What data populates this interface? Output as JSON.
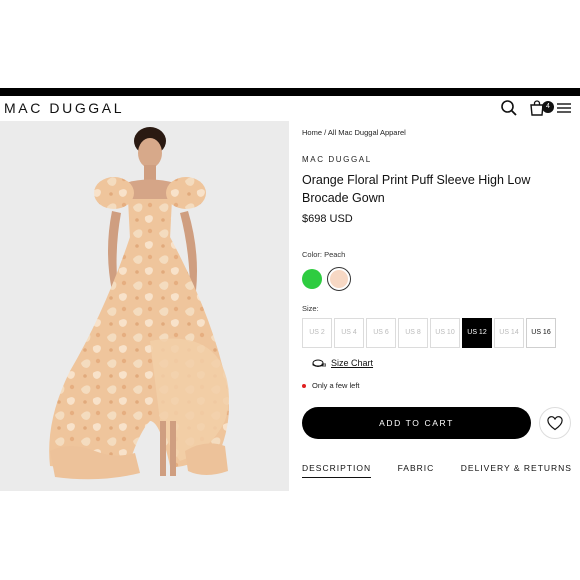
{
  "header": {
    "logo": "MAC DUGGAL",
    "cart_count": "4"
  },
  "colors": {
    "primary": "#000000",
    "swatch_green": "#2ecc40",
    "swatch_peach": "#f7d8c4",
    "stock_dot": "#e02020"
  },
  "product": {
    "breadcrumb": "Home / All Mac Duggal Apparel",
    "brand": "MAC DUGGAL",
    "title": "Orange Floral Print Puff Sleeve High Low Brocade Gown",
    "price": "$698 USD",
    "color_label": "Color: Peach",
    "size_label": "Size:",
    "sizes": [
      {
        "label": "US 2",
        "state": "unavailable"
      },
      {
        "label": "US 4",
        "state": "unavailable"
      },
      {
        "label": "US 6",
        "state": "unavailable"
      },
      {
        "label": "US 8",
        "state": "unavailable"
      },
      {
        "label": "US 10",
        "state": "unavailable"
      },
      {
        "label": "US 12",
        "state": "selected"
      },
      {
        "label": "US 14",
        "state": "unavailable"
      },
      {
        "label": "US 16",
        "state": "available"
      }
    ],
    "size_chart": "Size Chart",
    "stock": "Only a few left",
    "add_to_cart": "ADD TO CART"
  },
  "tabs": [
    {
      "label": "DESCRIPTION",
      "active": true
    },
    {
      "label": "FABRIC",
      "active": false
    },
    {
      "label": "DELIVERY & RETURNS",
      "active": false
    }
  ]
}
